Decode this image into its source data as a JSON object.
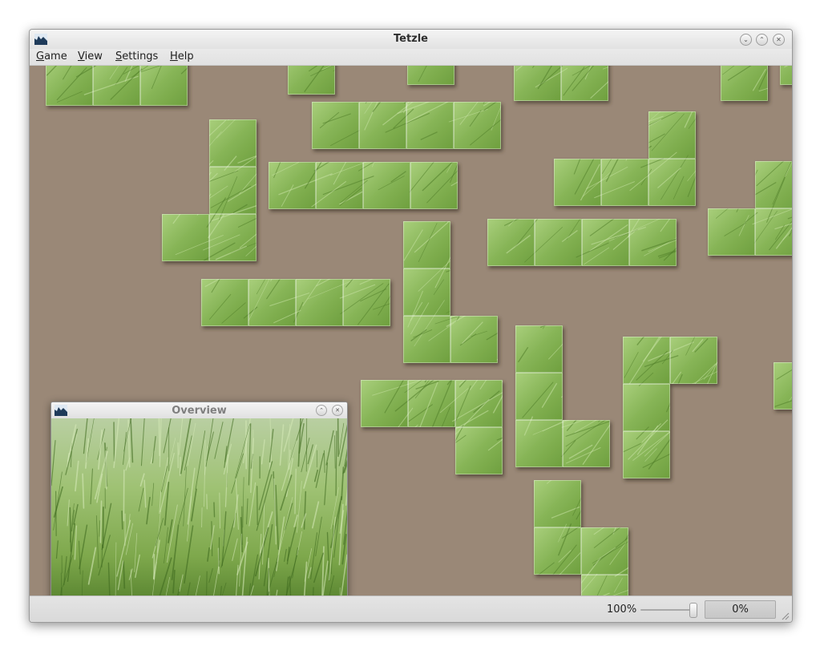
{
  "window": {
    "title": "Tetzle",
    "app_icon": "tetzle-app-icon",
    "buttons": [
      {
        "name": "help-button",
        "icon": "chevron-down-icon",
        "glyph": "⌄"
      },
      {
        "name": "maximize-button",
        "icon": "chevron-up-icon",
        "glyph": "⌃"
      },
      {
        "name": "close-button",
        "icon": "close-icon",
        "glyph": "✕"
      }
    ]
  },
  "menu": {
    "items": [
      {
        "label": "Game",
        "mnemonic": "G"
      },
      {
        "label": "View",
        "mnemonic": "V"
      },
      {
        "label": "Settings",
        "mnemonic": "S"
      },
      {
        "label": "Help",
        "mnemonic": "H"
      }
    ]
  },
  "board": {
    "background_color": "#9a8877",
    "piece_color": "#7fae4e",
    "piece_count": 17
  },
  "overview": {
    "title": "Overview",
    "buttons": [
      {
        "name": "overview-maximize-button",
        "icon": "chevron-up-icon",
        "glyph": "⌃"
      },
      {
        "name": "overview-close-button",
        "icon": "close-icon",
        "glyph": "✕"
      }
    ],
    "image_description": "wheat-field"
  },
  "status": {
    "zoom_label": "100%",
    "zoom_level": 1.0,
    "progress_label": "0%",
    "progress_fraction": 0.0
  },
  "colors": {
    "canvas": "#9a8877",
    "grass_dark": "#5f8f35",
    "grass_light": "#a8cf78"
  }
}
